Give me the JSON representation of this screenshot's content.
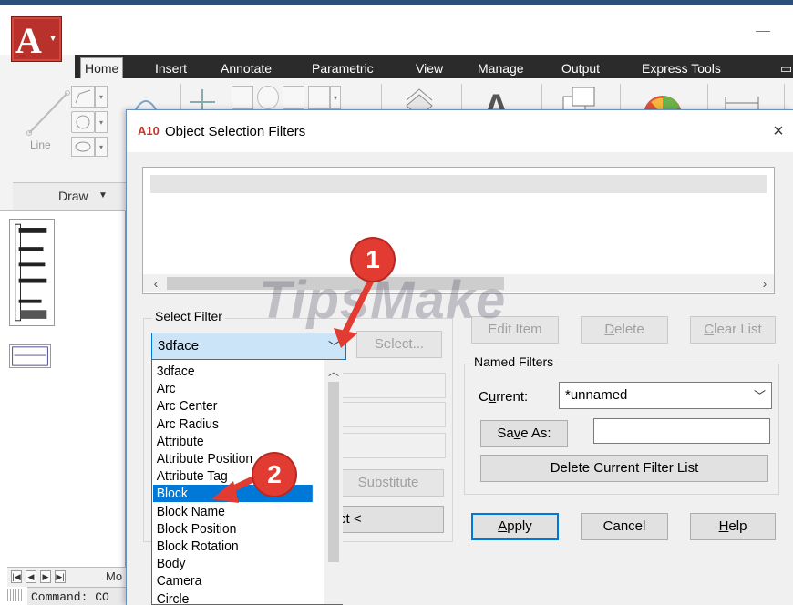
{
  "app": {
    "logo_letter": "A",
    "ribbon_tabs": [
      "Home",
      "Insert",
      "Annotate",
      "Parametric",
      "View",
      "Manage",
      "Output",
      "Express Tools"
    ],
    "active_tab": "Home",
    "line_tool_label": "Line",
    "draw_panel_label": "Draw",
    "layout_tab": "Mo",
    "command_prompt": "Command: CO"
  },
  "dialog": {
    "icon_text": "A10",
    "title": "Object Selection Filters",
    "close_glyph": "×",
    "select_filter": {
      "group_label": "Select Filter",
      "current_value": "3dface",
      "select_button": "Select...",
      "substitute_button": "Substitute",
      "add_button_fragment": "ct <"
    },
    "edit_buttons": {
      "edit_item": "Edit Item",
      "delete": "Delete",
      "clear_list": "Clear List"
    },
    "named_filters": {
      "group_label": "Named Filters",
      "current_label": "Current:",
      "current_value": "*unnamed",
      "save_as_button": "Save As:",
      "save_as_value": "",
      "delete_list_button": "Delete Current Filter List"
    },
    "bottom_buttons": {
      "apply": "Apply",
      "cancel": "Cancel",
      "help": "Help"
    }
  },
  "dropdown": {
    "items": [
      "3dface",
      "Arc",
      "Arc Center",
      "Arc Radius",
      "Attribute",
      "Attribute Position",
      "Attribute Tag",
      "Block",
      "Block Name",
      "Block Position",
      "Block Rotation",
      "Body",
      "Camera",
      "Circle"
    ],
    "selected_index": 7
  },
  "annotations": {
    "badge_1": "1",
    "badge_2": "2",
    "watermark": "TipsMake",
    "arrow_color": "#e23b32"
  },
  "colors": {
    "accent": "#0078d7",
    "autocad_red": "#b8312a",
    "ribbon_dark": "#2b2b2b"
  }
}
